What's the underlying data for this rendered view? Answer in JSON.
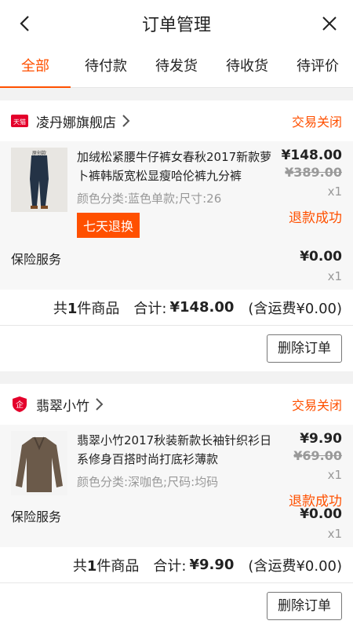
{
  "header": {
    "title": "订单管理"
  },
  "tabs": [
    "全部",
    "待付款",
    "待发货",
    "待收货",
    "待评价"
  ],
  "orders": [
    {
      "shop_badge": "天猫",
      "shop_name": "凌丹娜旗舰店",
      "status": "交易关闭",
      "item": {
        "thumb_text": "原创款",
        "title": "加绒松紧腰牛仔裤女春秋2017新款萝卜裤韩版宽松显瘦哈伦裤九分裤",
        "sku": "颜色分类:蓝色单款;尺寸:26",
        "badge": "七天退换",
        "price": "¥148.00",
        "old_price": "¥389.00",
        "qty": "x1",
        "refund": "退款成功"
      },
      "insurance": {
        "label": "保险服务",
        "price": "¥0.00",
        "qty": "x1"
      },
      "summary": {
        "count_prefix": "共",
        "count": "1",
        "count_suffix": "件商品",
        "total_label": "合计:",
        "total": "¥148.00",
        "shipping": "(含运费¥0.00)"
      },
      "action": "删除订单"
    },
    {
      "shop_badge": "企",
      "shop_name": "翡翠小竹",
      "status": "交易关闭",
      "item": {
        "title": "翡翠小竹2017秋装新款长袖针织衫日系修身百搭时尚打底衫薄款",
        "sku": "颜色分类:深咖色;尺码:均码",
        "price": "¥9.90",
        "old_price": "¥69.00",
        "qty": "x1",
        "refund": "退款成功"
      },
      "insurance": {
        "label": "保险服务",
        "price": "¥0.00",
        "qty": "x1"
      },
      "summary": {
        "count_prefix": "共",
        "count": "1",
        "count_suffix": "件商品",
        "total_label": "合计:",
        "total": "¥9.90",
        "shipping": "(含运费¥0.00)"
      },
      "action": "删除订单"
    }
  ],
  "colors": {
    "accent": "#ff5000",
    "muted": "#999999"
  }
}
